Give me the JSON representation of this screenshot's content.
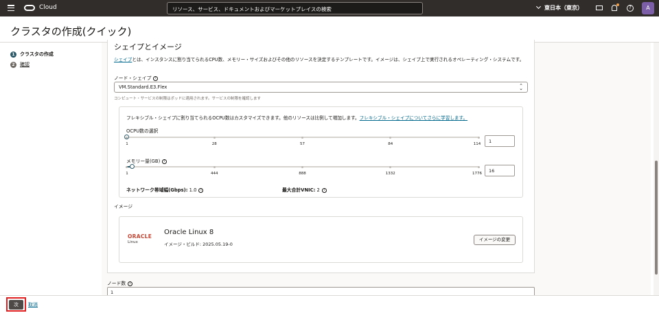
{
  "topbar": {
    "brand": "Cloud",
    "search_placeholder": "リソース、サービス、ドキュメントおよびマーケットプレイスの検索",
    "region": "東日本（東京）",
    "avatar_initial": "A"
  },
  "page": {
    "title": "クラスタの作成(クイック)"
  },
  "steps": [
    {
      "num": "1",
      "label": "クラスタの作成"
    },
    {
      "num": "2",
      "label": "確認"
    }
  ],
  "shape_section": {
    "heading": "シェイプとイメージ",
    "desc_link": "シェイプ",
    "desc_text": "とは、インスタンスに割り当てられるCPU数、メモリー・サイズおよびその他のリソースを決定するテンプレートです。イメージは、シェイプ上で実行されるオペレーティング・システムです。",
    "node_shape_label": "ノード・シェイプ",
    "node_shape_value": "VM.Standard.E3.Flex",
    "node_shape_hint": "コンピュート・サービスの制限はポッドに適用されます。サービスの制限を確認します",
    "flex_desc": "フレキシブル・シェイプに割り当てられるOCPU数はカスタマイズできます。他のリソースは比例して増加します。",
    "flex_link": "フレキシブル・シェイプについてさらに学習します。",
    "ocpu_label": "OCPU数の選択",
    "ocpu_ticks": [
      "1",
      "28",
      "57",
      "84",
      "114"
    ],
    "ocpu_value": "1",
    "ocpu_level": 0,
    "memory_label": "メモリー量(GB)",
    "memory_ticks": [
      "1",
      "444",
      "888",
      "1332",
      "1776"
    ],
    "memory_value": "16",
    "memory_level": 0.008,
    "network_label": "ネットワーク帯域幅(Gbps):",
    "network_value": "1.0",
    "vnic_label": "最大合計VNIC:",
    "vnic_value": "2",
    "image_label": "イメージ",
    "image_logo_word": "ORACLE",
    "image_logo_sub": "Linux",
    "image_name": "Oracle Linux 8",
    "image_build": "イメージ・ビルド: 2025.05.19-0",
    "change_image_btn": "イメージの変更"
  },
  "node_count": {
    "label": "ノード数",
    "value": "1"
  },
  "footer": {
    "next": "次",
    "cancel": "取消"
  },
  "colors": {
    "topbar": "#312d2a",
    "accent_link": "#00688c",
    "highlight_border": "#e02020"
  }
}
